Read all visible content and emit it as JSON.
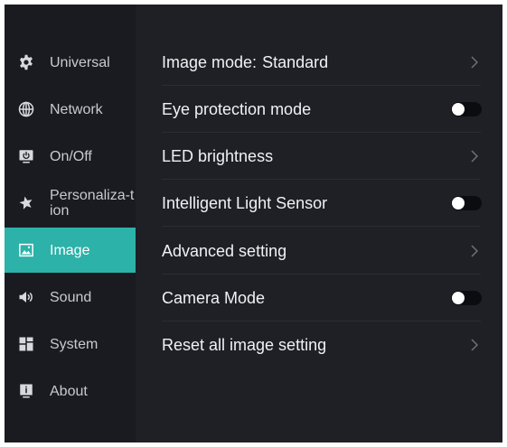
{
  "sidebar": {
    "items": [
      {
        "label": "Universal",
        "icon": "gear-icon"
      },
      {
        "label": "Network",
        "icon": "globe-icon"
      },
      {
        "label": "On/Off",
        "icon": "power-monitor-icon"
      },
      {
        "label": "Personaliza-tion",
        "icon": "star-icon"
      },
      {
        "label": "Image",
        "icon": "image-icon",
        "active": true
      },
      {
        "label": "Sound",
        "icon": "speaker-icon"
      },
      {
        "label": "System",
        "icon": "grid-icon"
      },
      {
        "label": "About",
        "icon": "info-icon"
      }
    ]
  },
  "settings": {
    "image_mode_label": "Image mode:",
    "image_mode_value": "Standard",
    "eye_protection_label": "Eye protection mode",
    "eye_protection_on": false,
    "led_brightness_label": "LED brightness",
    "light_sensor_label": "Intelligent Light Sensor",
    "light_sensor_on": false,
    "advanced_label": "Advanced setting",
    "camera_mode_label": "Camera Mode",
    "camera_mode_on": false,
    "reset_label": "Reset all image setting"
  },
  "colors": {
    "background": "#1e2026",
    "sidebar": "#1a1b20",
    "accent": "#2cb2a8",
    "text": "#f1f1f3"
  }
}
